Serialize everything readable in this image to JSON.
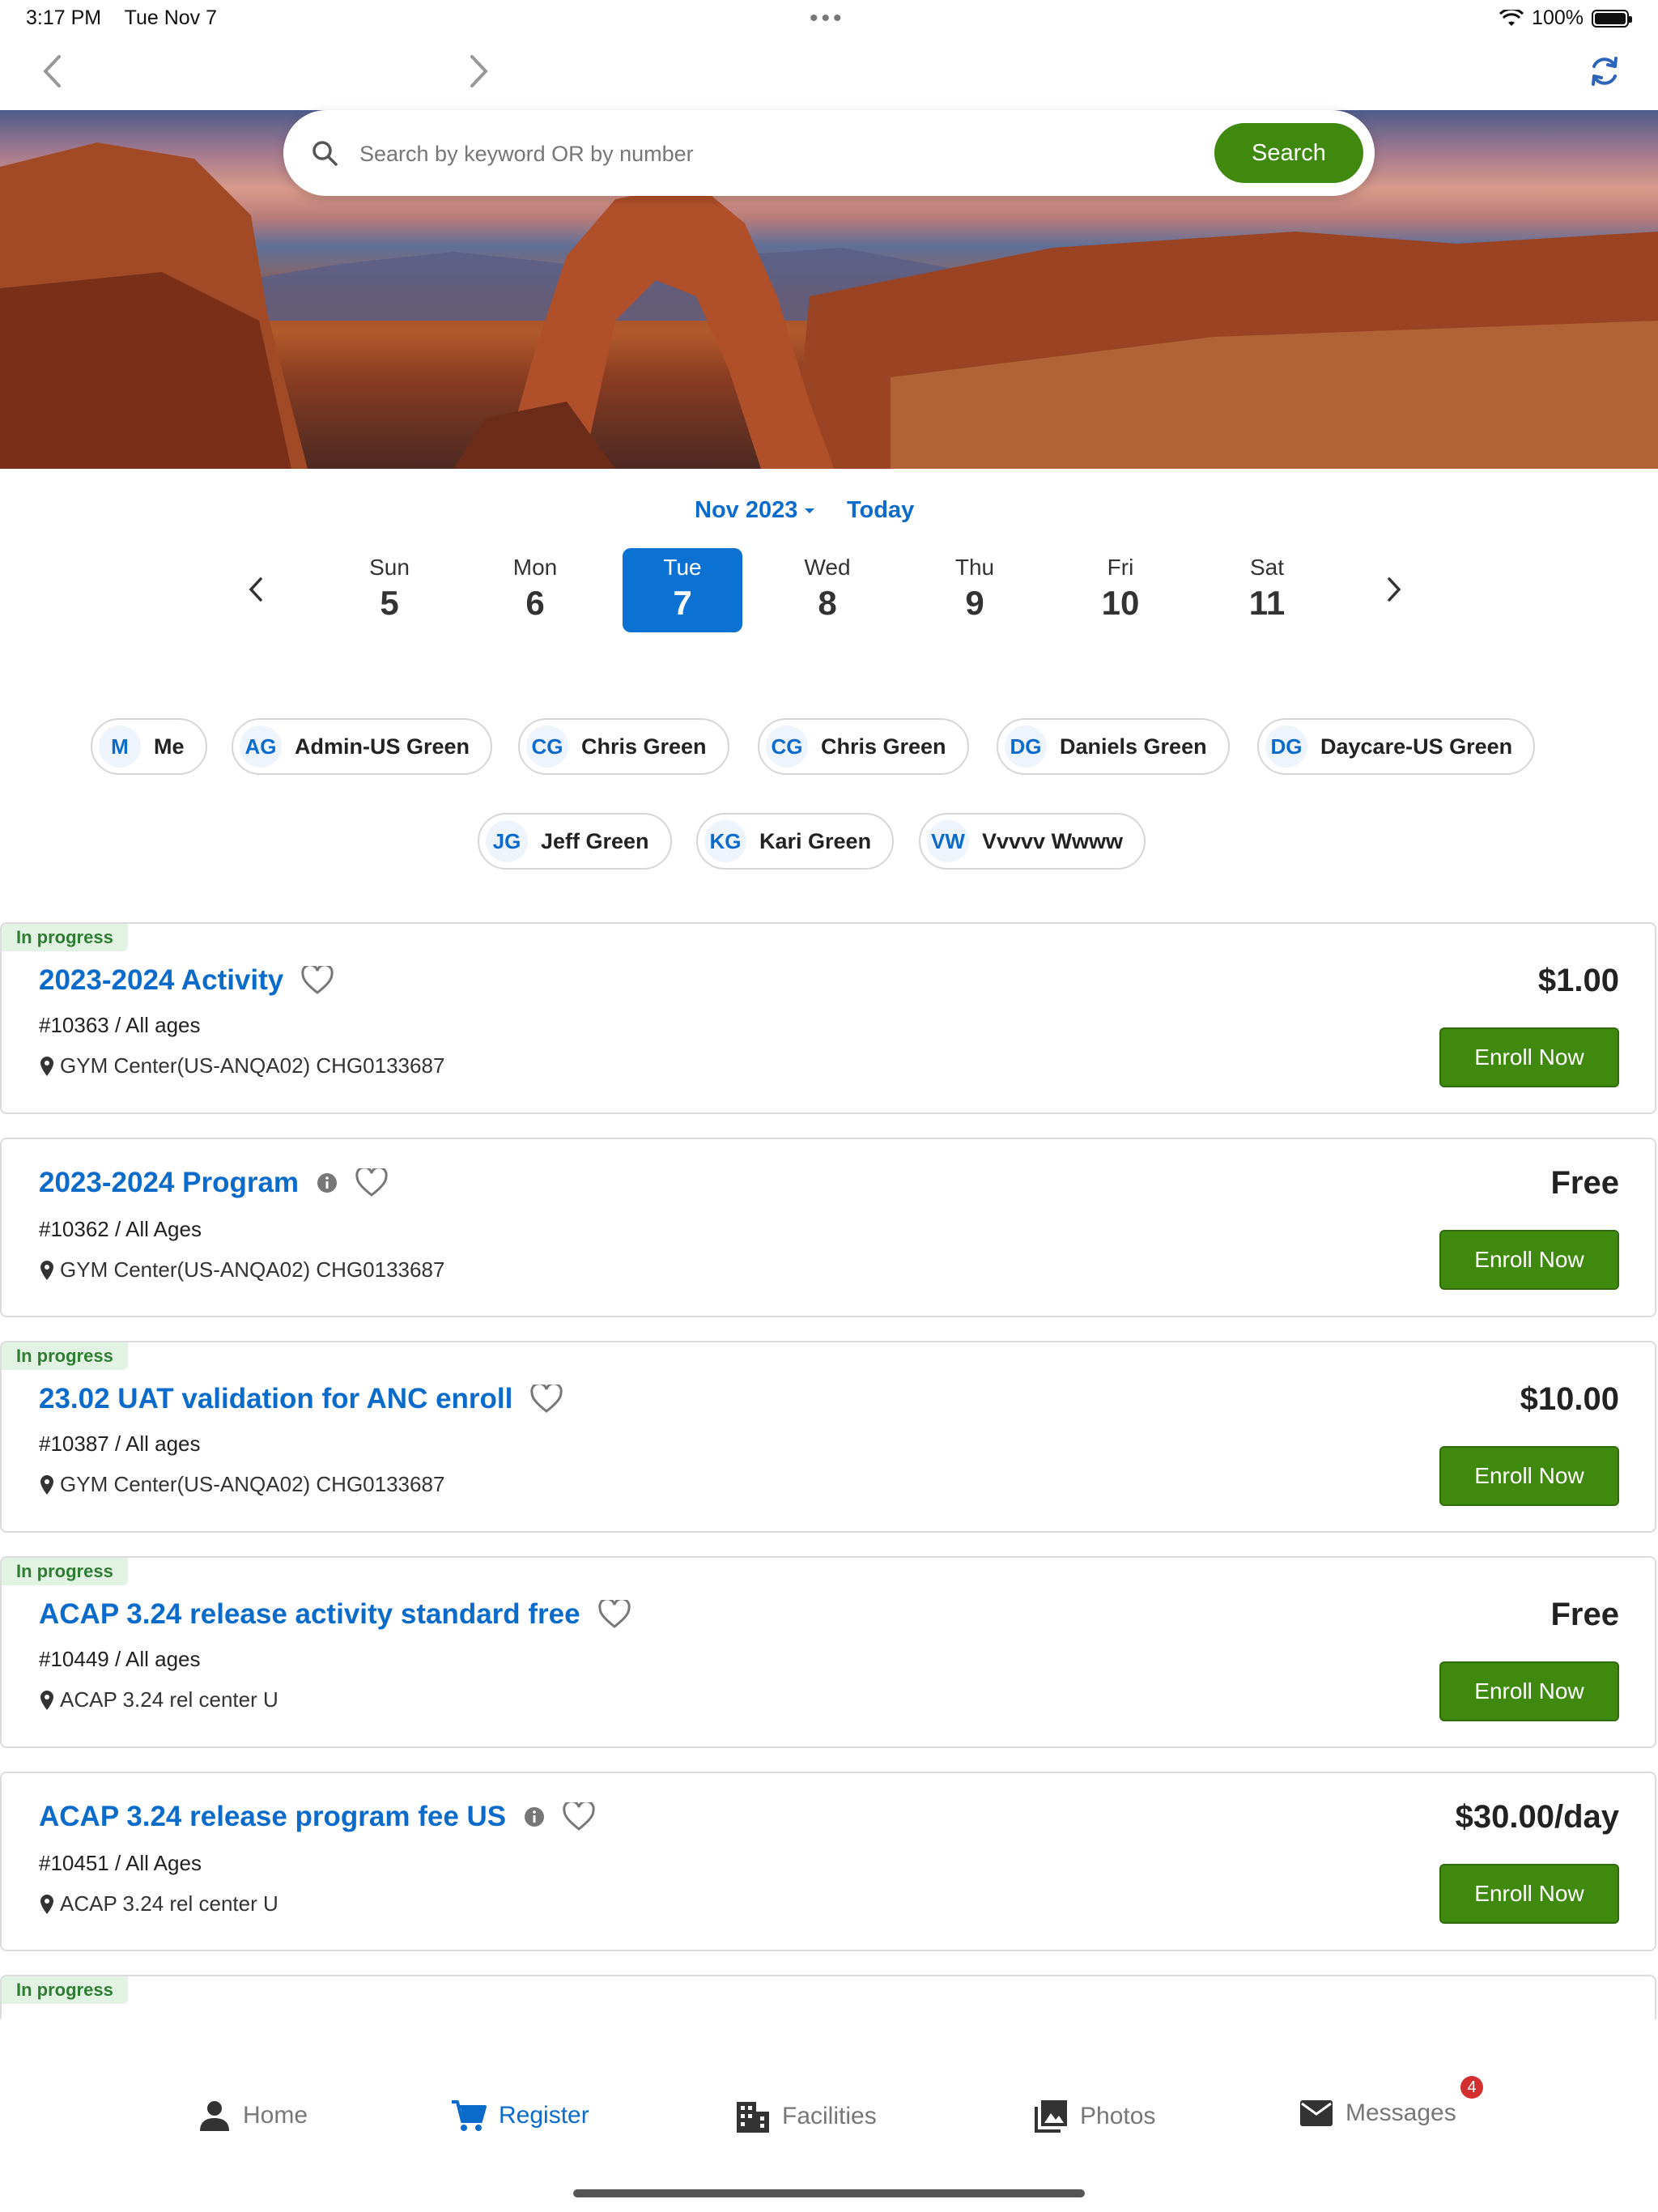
{
  "status_bar": {
    "time": "3:17 PM",
    "date": "Tue Nov 7",
    "battery": "100%"
  },
  "search": {
    "placeholder": "Search by keyword OR by number",
    "button_label": "Search"
  },
  "calendar": {
    "month_label": "Nov 2023",
    "today_label": "Today",
    "days": [
      {
        "name": "Sun",
        "date": "5"
      },
      {
        "name": "Mon",
        "date": "6"
      },
      {
        "name": "Tue",
        "date": "7",
        "selected": true
      },
      {
        "name": "Wed",
        "date": "8"
      },
      {
        "name": "Thu",
        "date": "9"
      },
      {
        "name": "Fri",
        "date": "10"
      },
      {
        "name": "Sat",
        "date": "11"
      }
    ]
  },
  "participants": [
    {
      "initials": "M",
      "name": "Me"
    },
    {
      "initials": "AG",
      "name": "Admin-US Green"
    },
    {
      "initials": "CG",
      "name": "Chris Green"
    },
    {
      "initials": "CG",
      "name": "Chris Green"
    },
    {
      "initials": "DG",
      "name": "Daniels Green"
    },
    {
      "initials": "DG",
      "name": "Daycare-US Green"
    },
    {
      "initials": "JG",
      "name": "Jeff Green"
    },
    {
      "initials": "KG",
      "name": "Kari Green"
    },
    {
      "initials": "VW",
      "name": "Vvvvv Wwww"
    }
  ],
  "activities": [
    {
      "badge": "In progress",
      "title": "2023-2024 Activity",
      "meta": "#10363 / All ages",
      "location": "GYM Center(US-ANQA02) CHG0133687",
      "price": "$1.00",
      "enroll_label": "Enroll Now"
    },
    {
      "badge": "",
      "title": "2023-2024 Program",
      "meta": "#10362 / All Ages",
      "location": "GYM Center(US-ANQA02) CHG0133687",
      "price": "Free",
      "enroll_label": "Enroll Now"
    },
    {
      "badge": "In progress",
      "title": "23.02 UAT validation for ANC enroll",
      "meta": "#10387 / All ages",
      "location": "GYM Center(US-ANQA02) CHG0133687",
      "price": "$10.00",
      "enroll_label": "Enroll Now"
    },
    {
      "badge": "In progress",
      "title": "ACAP 3.24 release activity standard free",
      "meta": "#10449 / All ages",
      "location": "ACAP 3.24 rel center U",
      "price": "Free",
      "enroll_label": "Enroll Now"
    },
    {
      "badge": "",
      "title": "ACAP 3.24 release program fee US",
      "meta": "#10451 / All Ages",
      "location": "ACAP 3.24 rel center U",
      "price": "$30.00/day",
      "enroll_label": "Enroll Now"
    },
    {
      "badge": "In progress"
    }
  ],
  "tabs": [
    {
      "label": "Home",
      "icon": "person-icon"
    },
    {
      "label": "Register",
      "icon": "cart-icon",
      "active": true
    },
    {
      "label": "Facilities",
      "icon": "building-icon"
    },
    {
      "label": "Photos",
      "icon": "photos-icon"
    },
    {
      "label": "Messages",
      "icon": "mail-icon",
      "badge": "4"
    }
  ],
  "colors": {
    "accent": "#0b6bcb",
    "button": "#3f8a0e",
    "badge_bg": "#e2f3e4",
    "badge_text": "#2e7d32",
    "notification": "#d32f2f"
  }
}
